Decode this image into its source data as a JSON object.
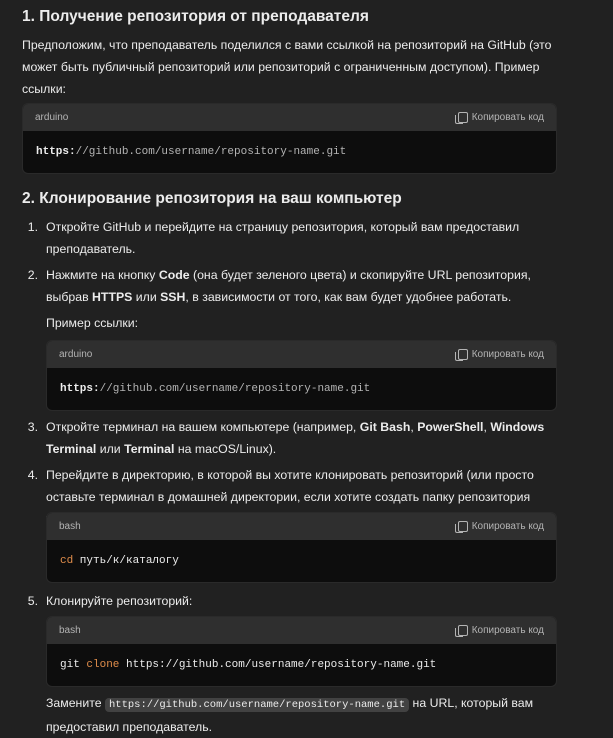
{
  "section1": {
    "title": "1. Получение репозитория от преподавателя",
    "paragraph": "Предположим, что преподаватель поделился с вами ссылкой на репозиторий на GitHub (это может быть публичный репозиторий или репозиторий с ограниченным доступом). Пример ссылки:",
    "code": {
      "lang": "arduino",
      "copy": "Копировать код",
      "prefix": "https:",
      "rest": "//github.com/username/repository-name.git"
    }
  },
  "section2": {
    "title": "2. Клонирование репозитория на ваш компьютер",
    "items": [
      {
        "num": "1.",
        "text": "Откройте GitHub и перейдите на страницу репозитория, который вам предоставил преподаватель."
      },
      {
        "num": "2.",
        "t1": "Нажмите на кнопку ",
        "b1": "Code",
        "t2": " (она будет зеленого цвета) и скопируйте URL репозитория, выбрав ",
        "b2": "HTTPS",
        "t3": " или ",
        "b3": "SSH",
        "t4": ", в зависимости от того, как вам будет удобнее работать.",
        "sub": "Пример ссылки:",
        "code": {
          "lang": "arduino",
          "copy": "Копировать код",
          "prefix": "https:",
          "rest": "//github.com/username/repository-name.git"
        }
      },
      {
        "num": "3.",
        "t1": "Откройте терминал на вашем компьютере (например, ",
        "b1": "Git Bash",
        "t2": ", ",
        "b2": "PowerShell",
        "t3": ", ",
        "b3": "Windows Terminal",
        "t4": " или ",
        "b4": "Terminal",
        "t5": " на macOS/Linux)."
      },
      {
        "num": "4.",
        "text": "Перейдите в директорию, в которой вы хотите клонировать репозиторий (или просто оставьте терминал в домашней директории, если хотите создать папку репозитория там):",
        "code": {
          "lang": "bash",
          "copy": "Копировать код",
          "kw": "cd",
          "rest": " путь/к/каталогу"
        }
      },
      {
        "num": "5.",
        "text": "Клонируйте репозиторий:",
        "code": {
          "lang": "bash",
          "copy": "Копировать код",
          "cmd": "git ",
          "kw": "clone",
          "rest": " https://github.com/username/repository-name.git"
        },
        "after1": "Замените ",
        "after_code": "https://github.com/username/repository-name.git",
        "after2": " на URL, который вам предоставил преподаватель."
      }
    ]
  }
}
